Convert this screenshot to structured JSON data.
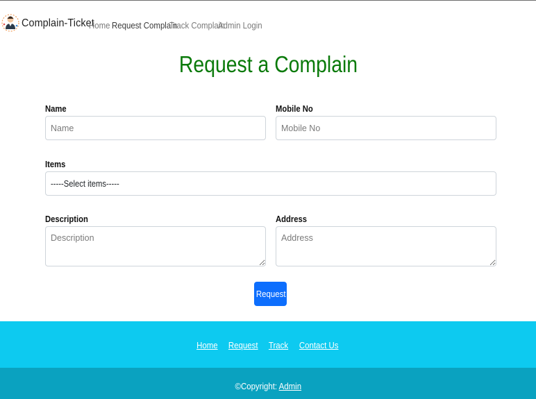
{
  "navbar": {
    "brand": "Complain-Ticket",
    "links": [
      {
        "label": "Home"
      },
      {
        "label": "Request Complain"
      },
      {
        "label": "Track Complain"
      },
      {
        "label": "Admin Login"
      }
    ]
  },
  "page": {
    "title": "Request a Complain"
  },
  "form": {
    "name": {
      "label": "Name",
      "placeholder": "Name",
      "value": ""
    },
    "mobile": {
      "label": "Mobile No",
      "placeholder": "Mobile No",
      "value": ""
    },
    "items": {
      "label": "Items",
      "selected": "-----Select items-----"
    },
    "description": {
      "label": "Description",
      "placeholder": "Description",
      "value": ""
    },
    "address": {
      "label": "Address",
      "placeholder": "Address",
      "value": ""
    },
    "submit_label": "Request"
  },
  "footer": {
    "links": [
      {
        "label": "Home"
      },
      {
        "label": "Request"
      },
      {
        "label": "Track"
      },
      {
        "label": "Contact Us"
      }
    ],
    "copyright_prefix": "©Copyright:",
    "copyright_link": "Admin"
  },
  "colors": {
    "title_green": "#0a7a0a",
    "primary_button": "#0d6efd",
    "footer_top": "#0dcaf0",
    "footer_bottom": "#0aa2c0"
  },
  "icons": {
    "brand_logo": "support-agent-icon"
  }
}
